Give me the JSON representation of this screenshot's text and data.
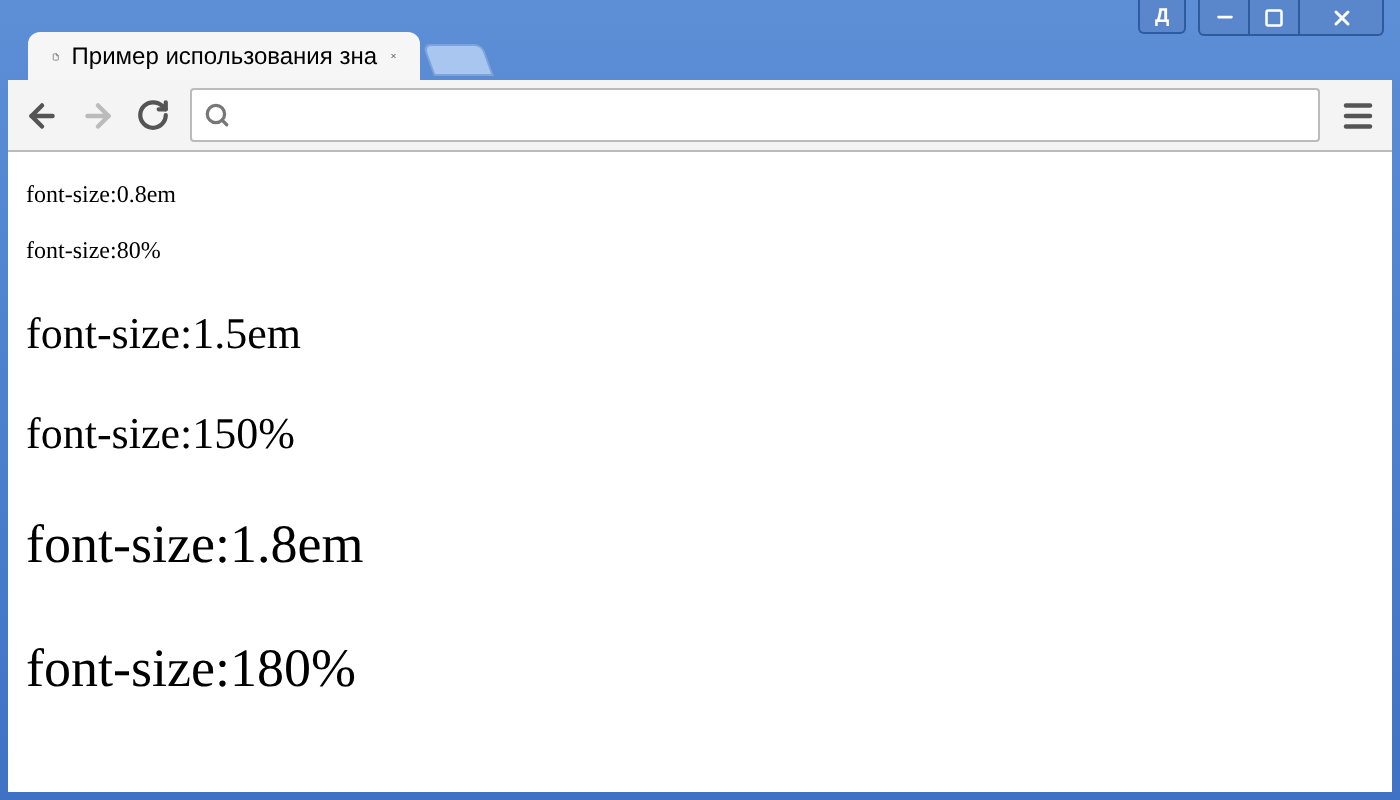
{
  "window": {
    "lang_badge": "Д"
  },
  "tabs": [
    {
      "title": "Пример использования зна",
      "selected": true
    }
  ],
  "content": [
    {
      "text": "font-size:0.8em",
      "kind": "small"
    },
    {
      "text": "font-size:80%",
      "kind": "small"
    },
    {
      "text": "font-size:1.5em",
      "kind": "medium"
    },
    {
      "text": "font-size:150%",
      "kind": "medium"
    },
    {
      "text": "font-size:1.8em",
      "kind": "large"
    },
    {
      "text": "font-size:180%",
      "kind": "large"
    }
  ]
}
